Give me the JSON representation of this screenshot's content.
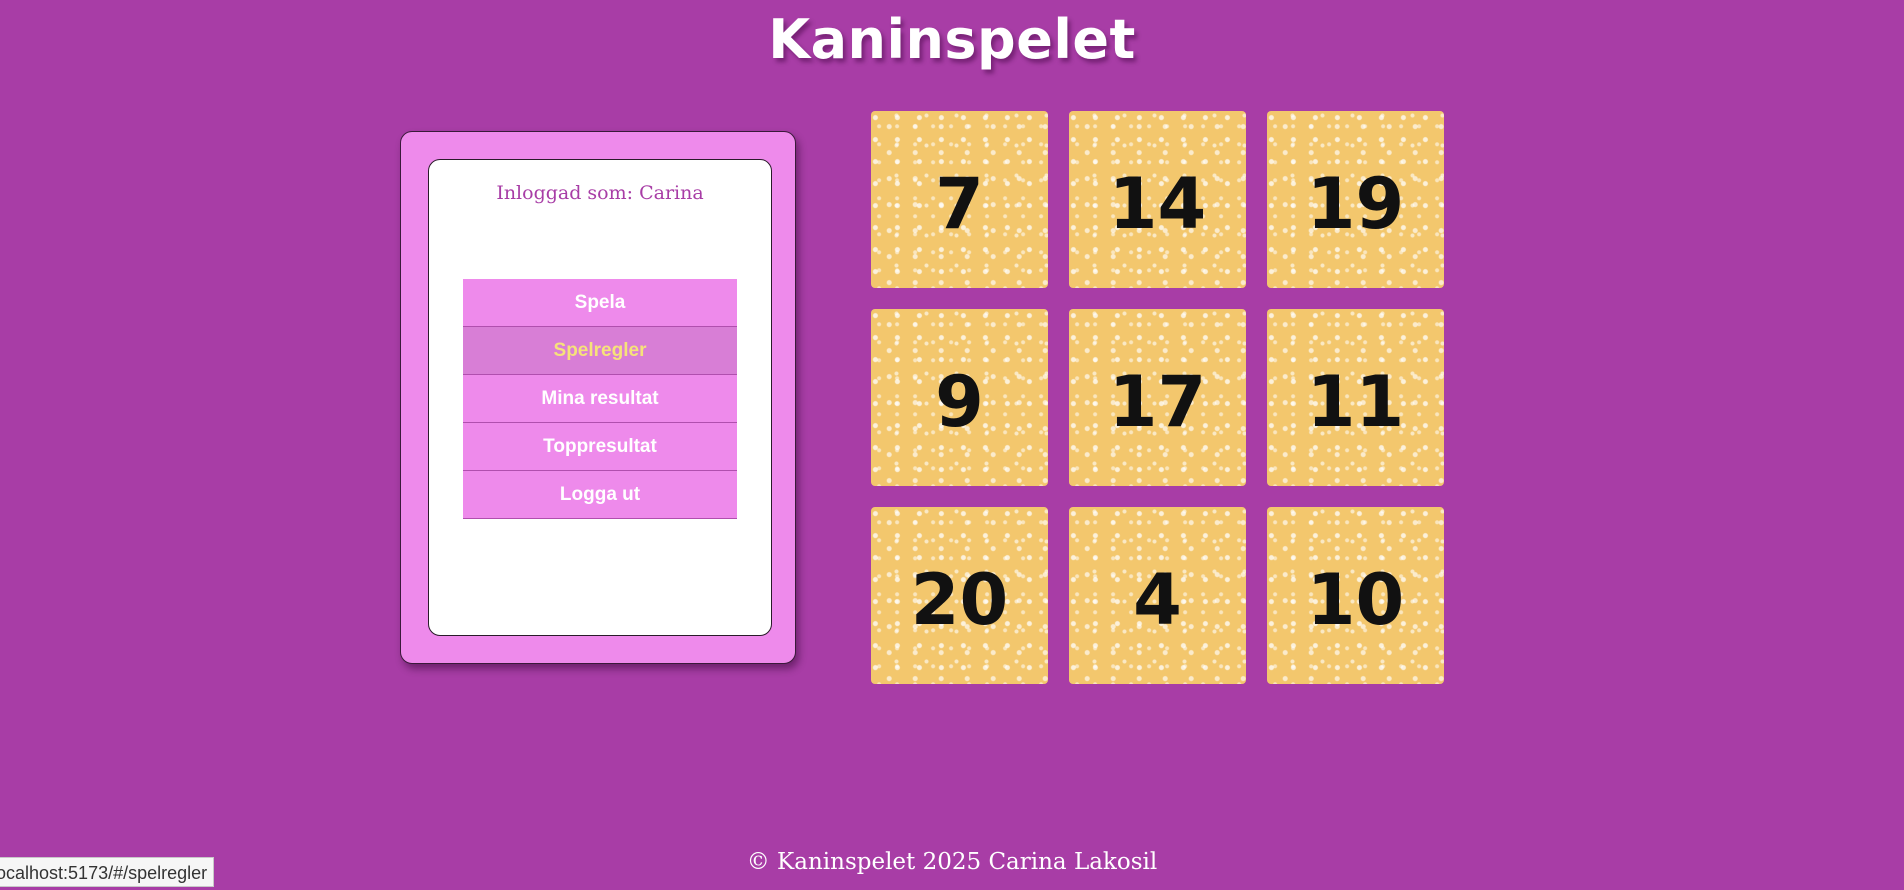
{
  "app": {
    "title": "Kaninspelet"
  },
  "sidebar": {
    "logged_in_text": "Inloggad som: Carina",
    "menu": [
      {
        "label": "Spela",
        "active": false
      },
      {
        "label": "Spelregler",
        "active": true
      },
      {
        "label": "Mina resultat",
        "active": false
      },
      {
        "label": "Toppresultat",
        "active": false
      },
      {
        "label": "Logga ut",
        "active": false
      }
    ]
  },
  "board": {
    "tiles": [
      "7",
      "14",
      "19",
      "9",
      "17",
      "11",
      "20",
      "4",
      "10"
    ]
  },
  "footer": {
    "text": "© Kaninspelet 2025 Carina Lakosil"
  },
  "status_bar": {
    "url": "ocalhost:5173/#/spelregler"
  },
  "colors": {
    "background": "#a83da6",
    "menu_pink": "#ee8aeb",
    "active_item": "#d87ed6",
    "active_text": "#f6e27a",
    "tile": "#f3c76d"
  }
}
